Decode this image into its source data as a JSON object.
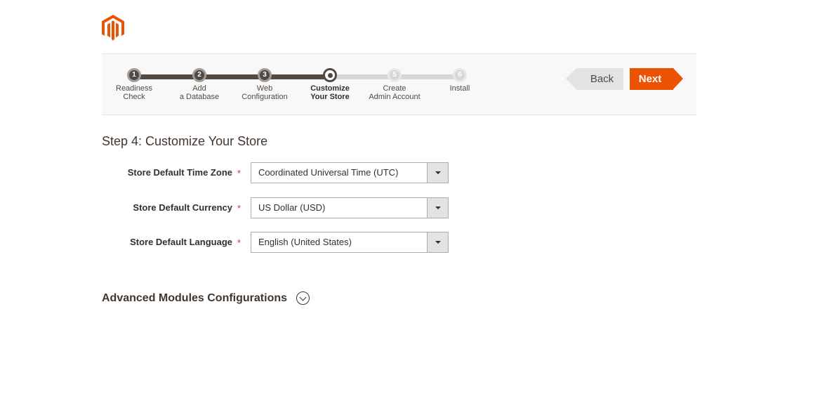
{
  "brand": {
    "logo_icon": "magento-logo-icon",
    "accent_color": "#eb5202"
  },
  "progress": {
    "steps": [
      {
        "number": "1",
        "label_line1": "Readiness",
        "label_line2": "Check",
        "state": "done"
      },
      {
        "number": "2",
        "label_line1": "Add",
        "label_line2": "a Database",
        "state": "done"
      },
      {
        "number": "3",
        "label_line1": "Web",
        "label_line2": "Configuration",
        "state": "done"
      },
      {
        "number": "",
        "label_line1": "Customize",
        "label_line2": "Your Store",
        "state": "active"
      },
      {
        "number": "5",
        "label_line1": "Create",
        "label_line2": "Admin Account",
        "state": "todo"
      },
      {
        "number": "6",
        "label_line1": "Install",
        "label_line2": "",
        "state": "todo"
      }
    ],
    "back_label": "Back",
    "next_label": "Next"
  },
  "page": {
    "title": "Step 4: Customize Your Store",
    "required_marker": "*",
    "fields": {
      "timezone": {
        "label": "Store Default Time Zone",
        "value": "Coordinated Universal Time (UTC)"
      },
      "currency": {
        "label": "Store Default Currency",
        "value": "US Dollar (USD)"
      },
      "language": {
        "label": "Store Default Language",
        "value": "English (United States)"
      }
    },
    "advanced_title": "Advanced Modules Configurations"
  }
}
